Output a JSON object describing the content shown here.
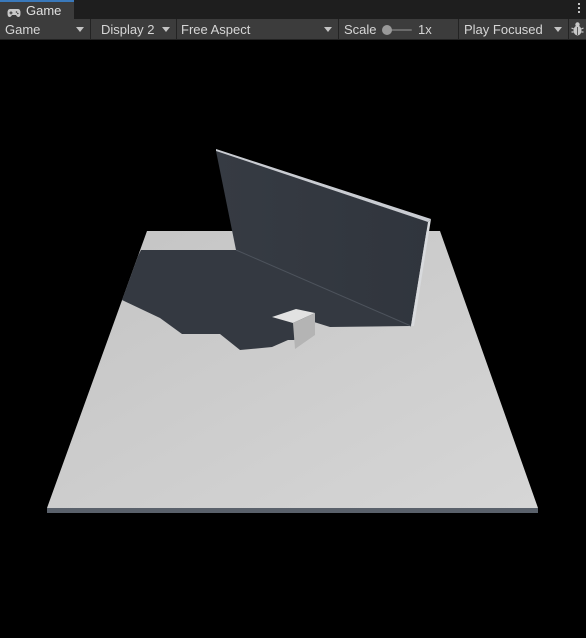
{
  "tab": {
    "title": "Game",
    "icon": "gamepad-icon"
  },
  "toolbar": {
    "view_mode": "Game",
    "display": "Display 2",
    "aspect": "Free Aspect",
    "scale_label": "Scale",
    "scale_value": "1x",
    "play_mode": "Play Focused"
  },
  "icons": {
    "menu": "kebab-menu-icon",
    "stats": "bug-icon"
  },
  "colors": {
    "tab_accent": "#3a79bb",
    "toolbar_bg": "#3c3c3c",
    "viewport_bg": "#000000",
    "floor": "#c8c8c8",
    "wall": "#333840",
    "shadow": "#343941"
  }
}
